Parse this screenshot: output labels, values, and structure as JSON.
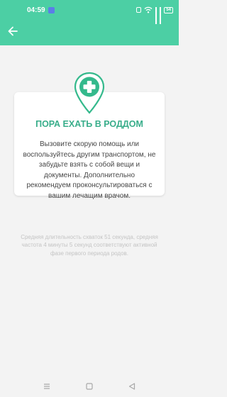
{
  "status_bar": {
    "time": "04:59",
    "battery": "54"
  },
  "card": {
    "title": "ПОРА ЕХАТЬ В РОДДОМ",
    "body": "Вызовите скорую помощь или воспользуйтесь другим транспортом, не забудьте взять с собой вещи и документы. Дополнительно рекомендуем проконсультироваться с вашим лечащим врачом."
  },
  "footnote": "Средняя длительность схваток 51 секунда, средняя частота 4 минуты 5 секунд соответствуют активной фазе первого периода родов.",
  "colors": {
    "accent": "#4ccfa4",
    "title": "#38ad8a",
    "pin": "#34b98c"
  },
  "icons": {
    "back": "arrow-left-icon",
    "pin": "medical-cross-pin-icon",
    "nav_menu": "menu-icon",
    "nav_home": "square-icon",
    "nav_back": "triangle-back-icon"
  }
}
